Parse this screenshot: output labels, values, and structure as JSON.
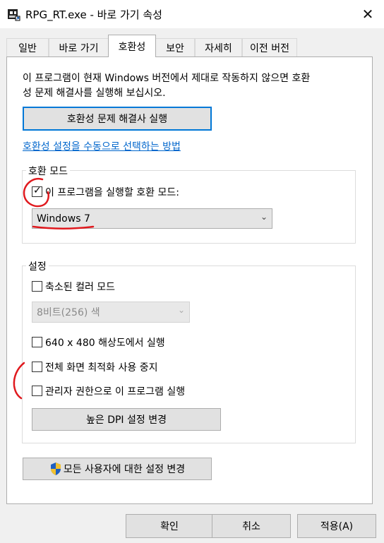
{
  "window": {
    "title": "RPG_RT.exe - 바로 가기 속성",
    "close_glyph": "✕"
  },
  "tabs": [
    {
      "label": "일반"
    },
    {
      "label": "바로 가기"
    },
    {
      "label": "호환성",
      "active": true
    },
    {
      "label": "보안"
    },
    {
      "label": "자세히"
    },
    {
      "label": "이전 버전"
    }
  ],
  "intro": {
    "line1": "이 프로그램이 현재 Windows 버전에서 제대로 작동하지 않으면 호환",
    "line2": "성 문제 해결사를 실행해 보십시오."
  },
  "troubleshooter_button": "호환성 문제 해결사 실행",
  "manual_link": "호환성 설정을 수동으로 선택하는 방법",
  "compat_mode": {
    "legend": "호환 모드",
    "checkbox_label": "이 프로그램을 실행할 호환 모드:",
    "checked": true,
    "selected_os": "Windows 7"
  },
  "settings": {
    "legend": "설정",
    "reduced_color": {
      "label": "축소된 컬러 모드",
      "checked": false
    },
    "color_select": "8비트(256) 색",
    "res_640": {
      "label": "640 x 480 해상도에서 실행",
      "checked": false
    },
    "fullscreen_opt": {
      "label": "전체 화면 최적화 사용 중지",
      "checked": false
    },
    "run_as_admin": {
      "label": "관리자 권한으로 이 프로그램 실행",
      "checked": false
    },
    "dpi_button": "높은 DPI 설정 변경"
  },
  "all_users_button": "모든 사용자에 대한 설정 변경",
  "dialog_buttons": {
    "ok": "확인",
    "cancel": "취소",
    "apply": "적용(A)"
  },
  "colors": {
    "annotation_red": "#e0191e",
    "focus_blue": "#0078d7",
    "link_blue": "#0066cc"
  }
}
